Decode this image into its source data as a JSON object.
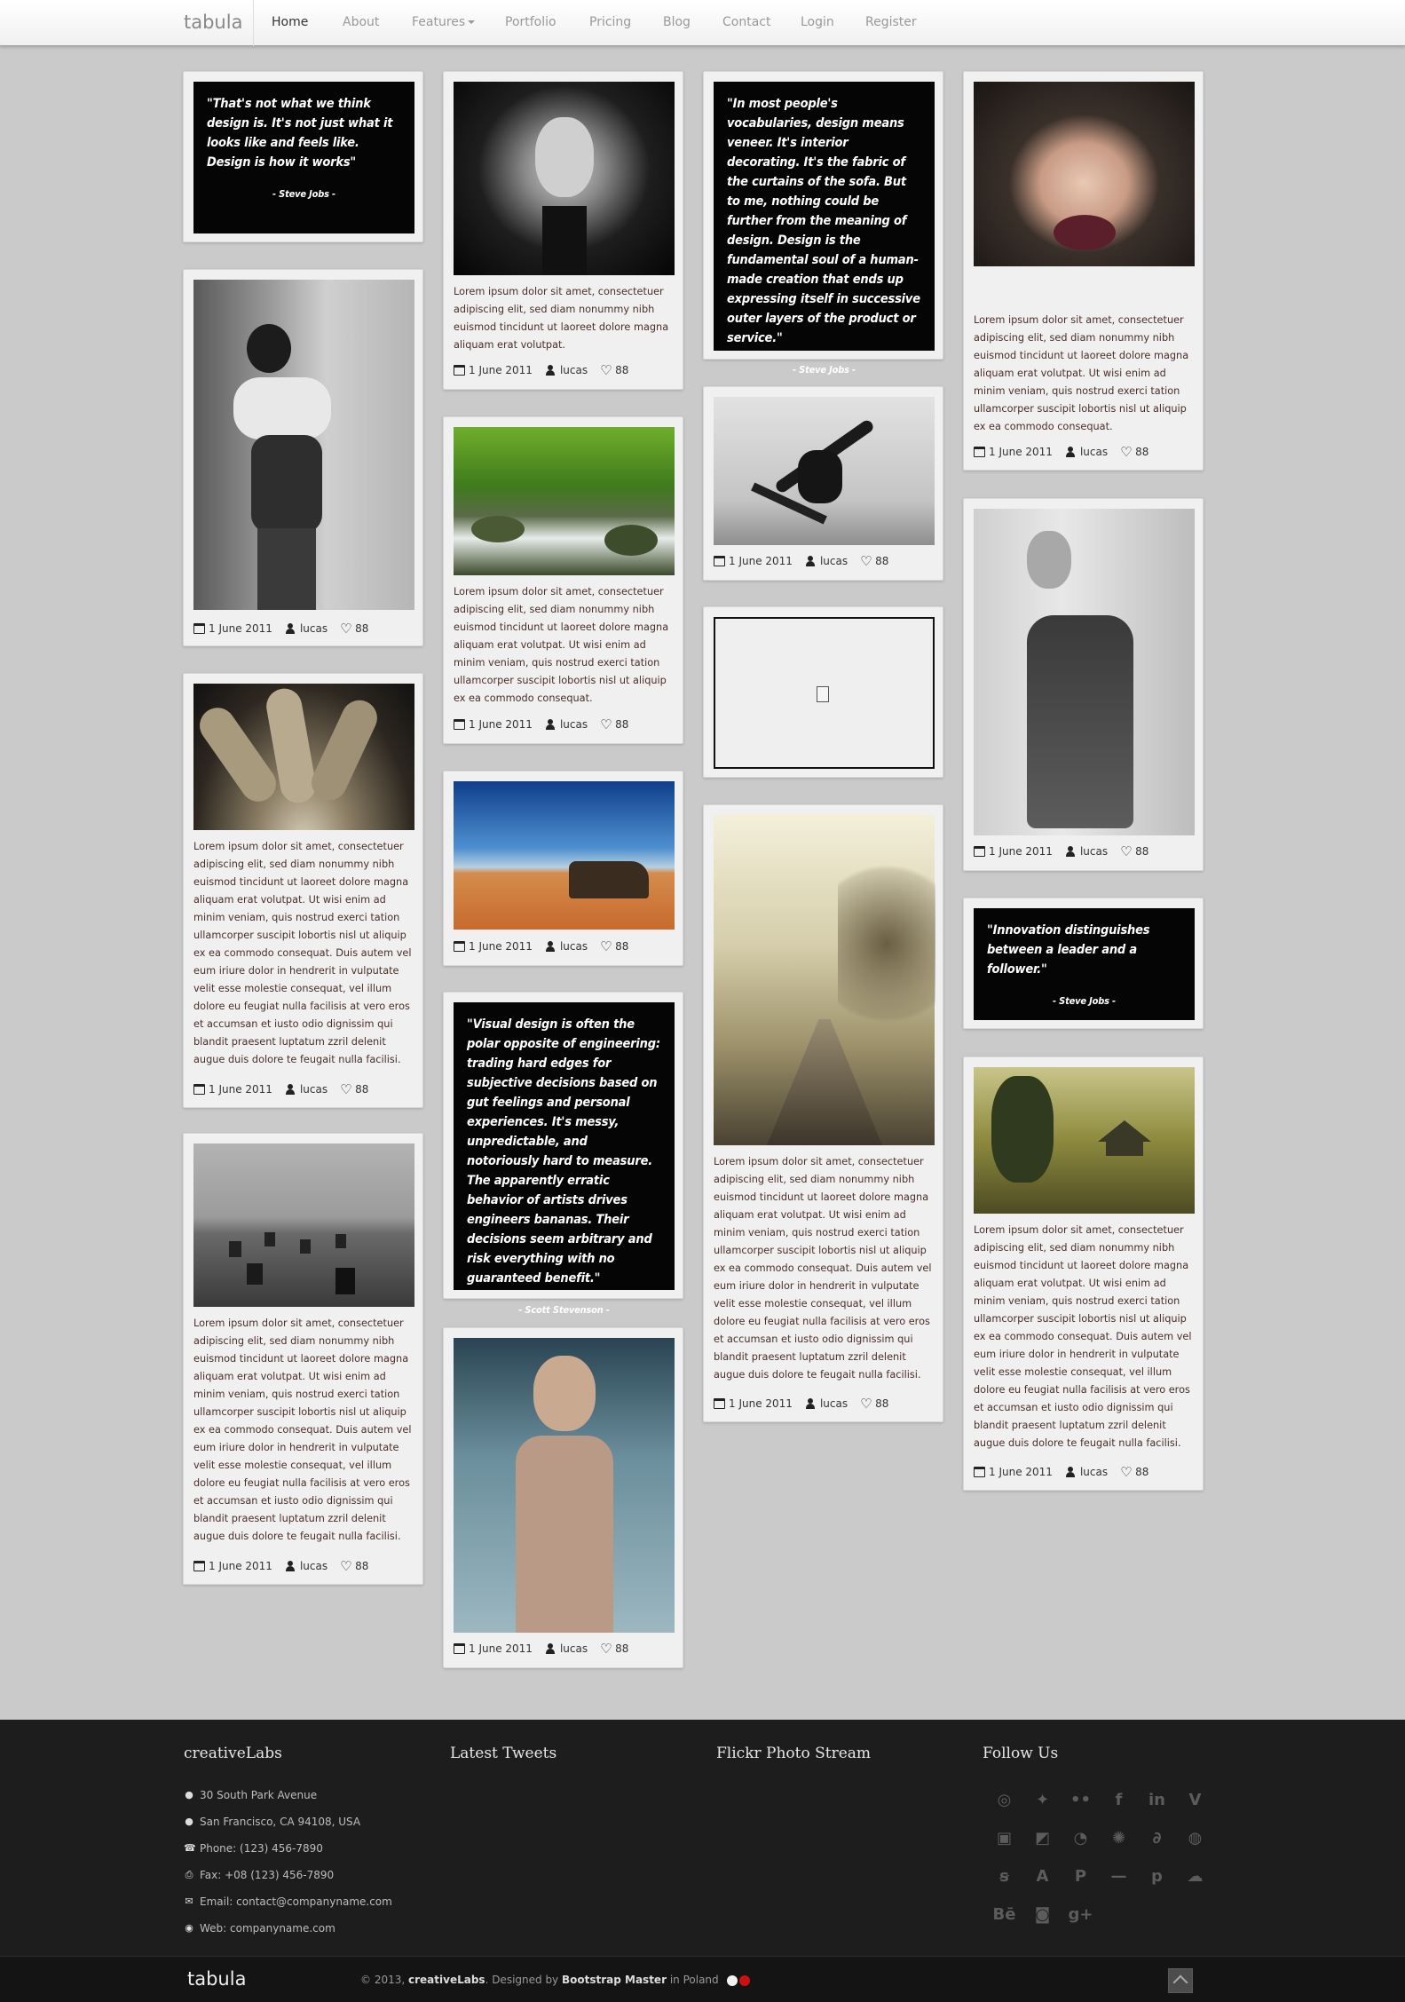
{
  "nav": {
    "brand": "tabula",
    "items": [
      {
        "label": "Home",
        "active": true
      },
      {
        "label": "About"
      },
      {
        "label": "Features",
        "dropdown": true
      },
      {
        "label": "Portfolio"
      },
      {
        "label": "Pricing"
      },
      {
        "label": "Blog"
      },
      {
        "label": "Contact"
      },
      {
        "label": "Login"
      },
      {
        "label": "Register"
      }
    ]
  },
  "posts": {
    "quote_jobs_design": {
      "text": "\"That's not what we think design is. It's not just what it looks like and feels like. Design is how it works\"",
      "author": "- Steve Jobs -"
    },
    "quote_vocab": {
      "text": "\"In most people's vocabularies, design means veneer. It's interior decorating. It's the fabric of the curtains of the sofa. But to me, nothing could be further from the meaning of design. Design is the fundamental soul of a human-made creation that ends up expressing itself in successive outer layers of the product or service.\"",
      "author": "- Steve Jobs -"
    },
    "quote_innovation": {
      "text": "\"Innovation distinguishes between a leader and a follower.\"",
      "author": "- Steve Jobs -"
    },
    "quote_visual": {
      "text": "\"Visual design is often the polar opposite of engineering: trading hard edges for subjective decisions based on gut feelings and personal experiences. It's messy, unpredictable, and notoriously hard to measure. The apparently erratic behavior of artists drives engineers bananas. Their decisions seem arbitrary and risk everything with no guaranteed benefit.\"",
      "author": "- Scott Stevenson -"
    },
    "lorem_short": "Lorem ipsum dolor sit amet, consectetuer adipiscing elit, sed diam nonummy nibh euismod tincidunt ut laoreet dolore magna aliquam erat volutpat.",
    "lorem_medium": "Lorem ipsum dolor sit amet, consectetuer adipiscing elit, sed diam nonummy nibh euismod tincidunt ut laoreet dolore magna aliquam erat volutpat. Ut wisi enim ad minim veniam, quis nostrud exerci tation ullamcorper suscipit lobortis nisl ut aliquip ex ea commodo consequat.",
    "lorem_long": "Lorem ipsum dolor sit amet, consectetuer adipiscing elit, sed diam nonummy nibh euismod tincidunt ut laoreet dolore magna aliquam erat volutpat. Ut wisi enim ad minim veniam, quis nostrud exerci tation ullamcorper suscipit lobortis nisl ut aliquip ex ea commodo consequat. Duis autem vel eum iriure dolor in hendrerit in vulputate velit esse molestie consequat, vel illum dolore eu feugiat nulla facilisis at vero eros et accumsan et iusto odio dignissim qui blandit praesent luptatum zzril delenit augue duis dolore te feugait nulla facilisi.",
    "meta": {
      "date": "1 June 2011",
      "author": "lucas",
      "likes": "88"
    }
  },
  "footer": {
    "company": {
      "title": "creativeLabs",
      "address1": "30 South Park Avenue",
      "address2": "San Francisco, CA 94108, USA",
      "phone": "Phone: (123) 456-7890",
      "fax": "Fax: +08 (123) 456-7890",
      "email": "Email: contact@companyname.com",
      "web": "Web: companyname.com"
    },
    "tweets_title": "Latest Tweets",
    "flickr_title": "Flickr Photo Stream",
    "follow_title": "Follow Us",
    "social_icons": [
      "dribbble-icon",
      "twitter-icon",
      "flickr-icon",
      "facebook-icon",
      "linkedin-icon",
      "vimeo-icon",
      "youtube-icon",
      "delicious-icon",
      "rss-icon",
      "picasa-icon",
      "deviantart-icon",
      "skype-icon",
      "lastfm-icon",
      "appstore-icon",
      "paypal-icon",
      "hyphen-icon",
      "pinterest-icon",
      "soundcloud-icon",
      "behance-icon",
      "instagram-icon",
      "googleplus-icon"
    ]
  },
  "bottombar": {
    "brand": "tabula",
    "copyright": "© 2013,",
    "company": "creativeLabs",
    "designed_by": ". Designed by",
    "designer": "Bootstrap Master",
    "location": "in Poland"
  },
  "colors": {
    "accent_red": "#cc1111",
    "footer_bg": "#1d1d1d",
    "page_bg": "#cacaca"
  }
}
